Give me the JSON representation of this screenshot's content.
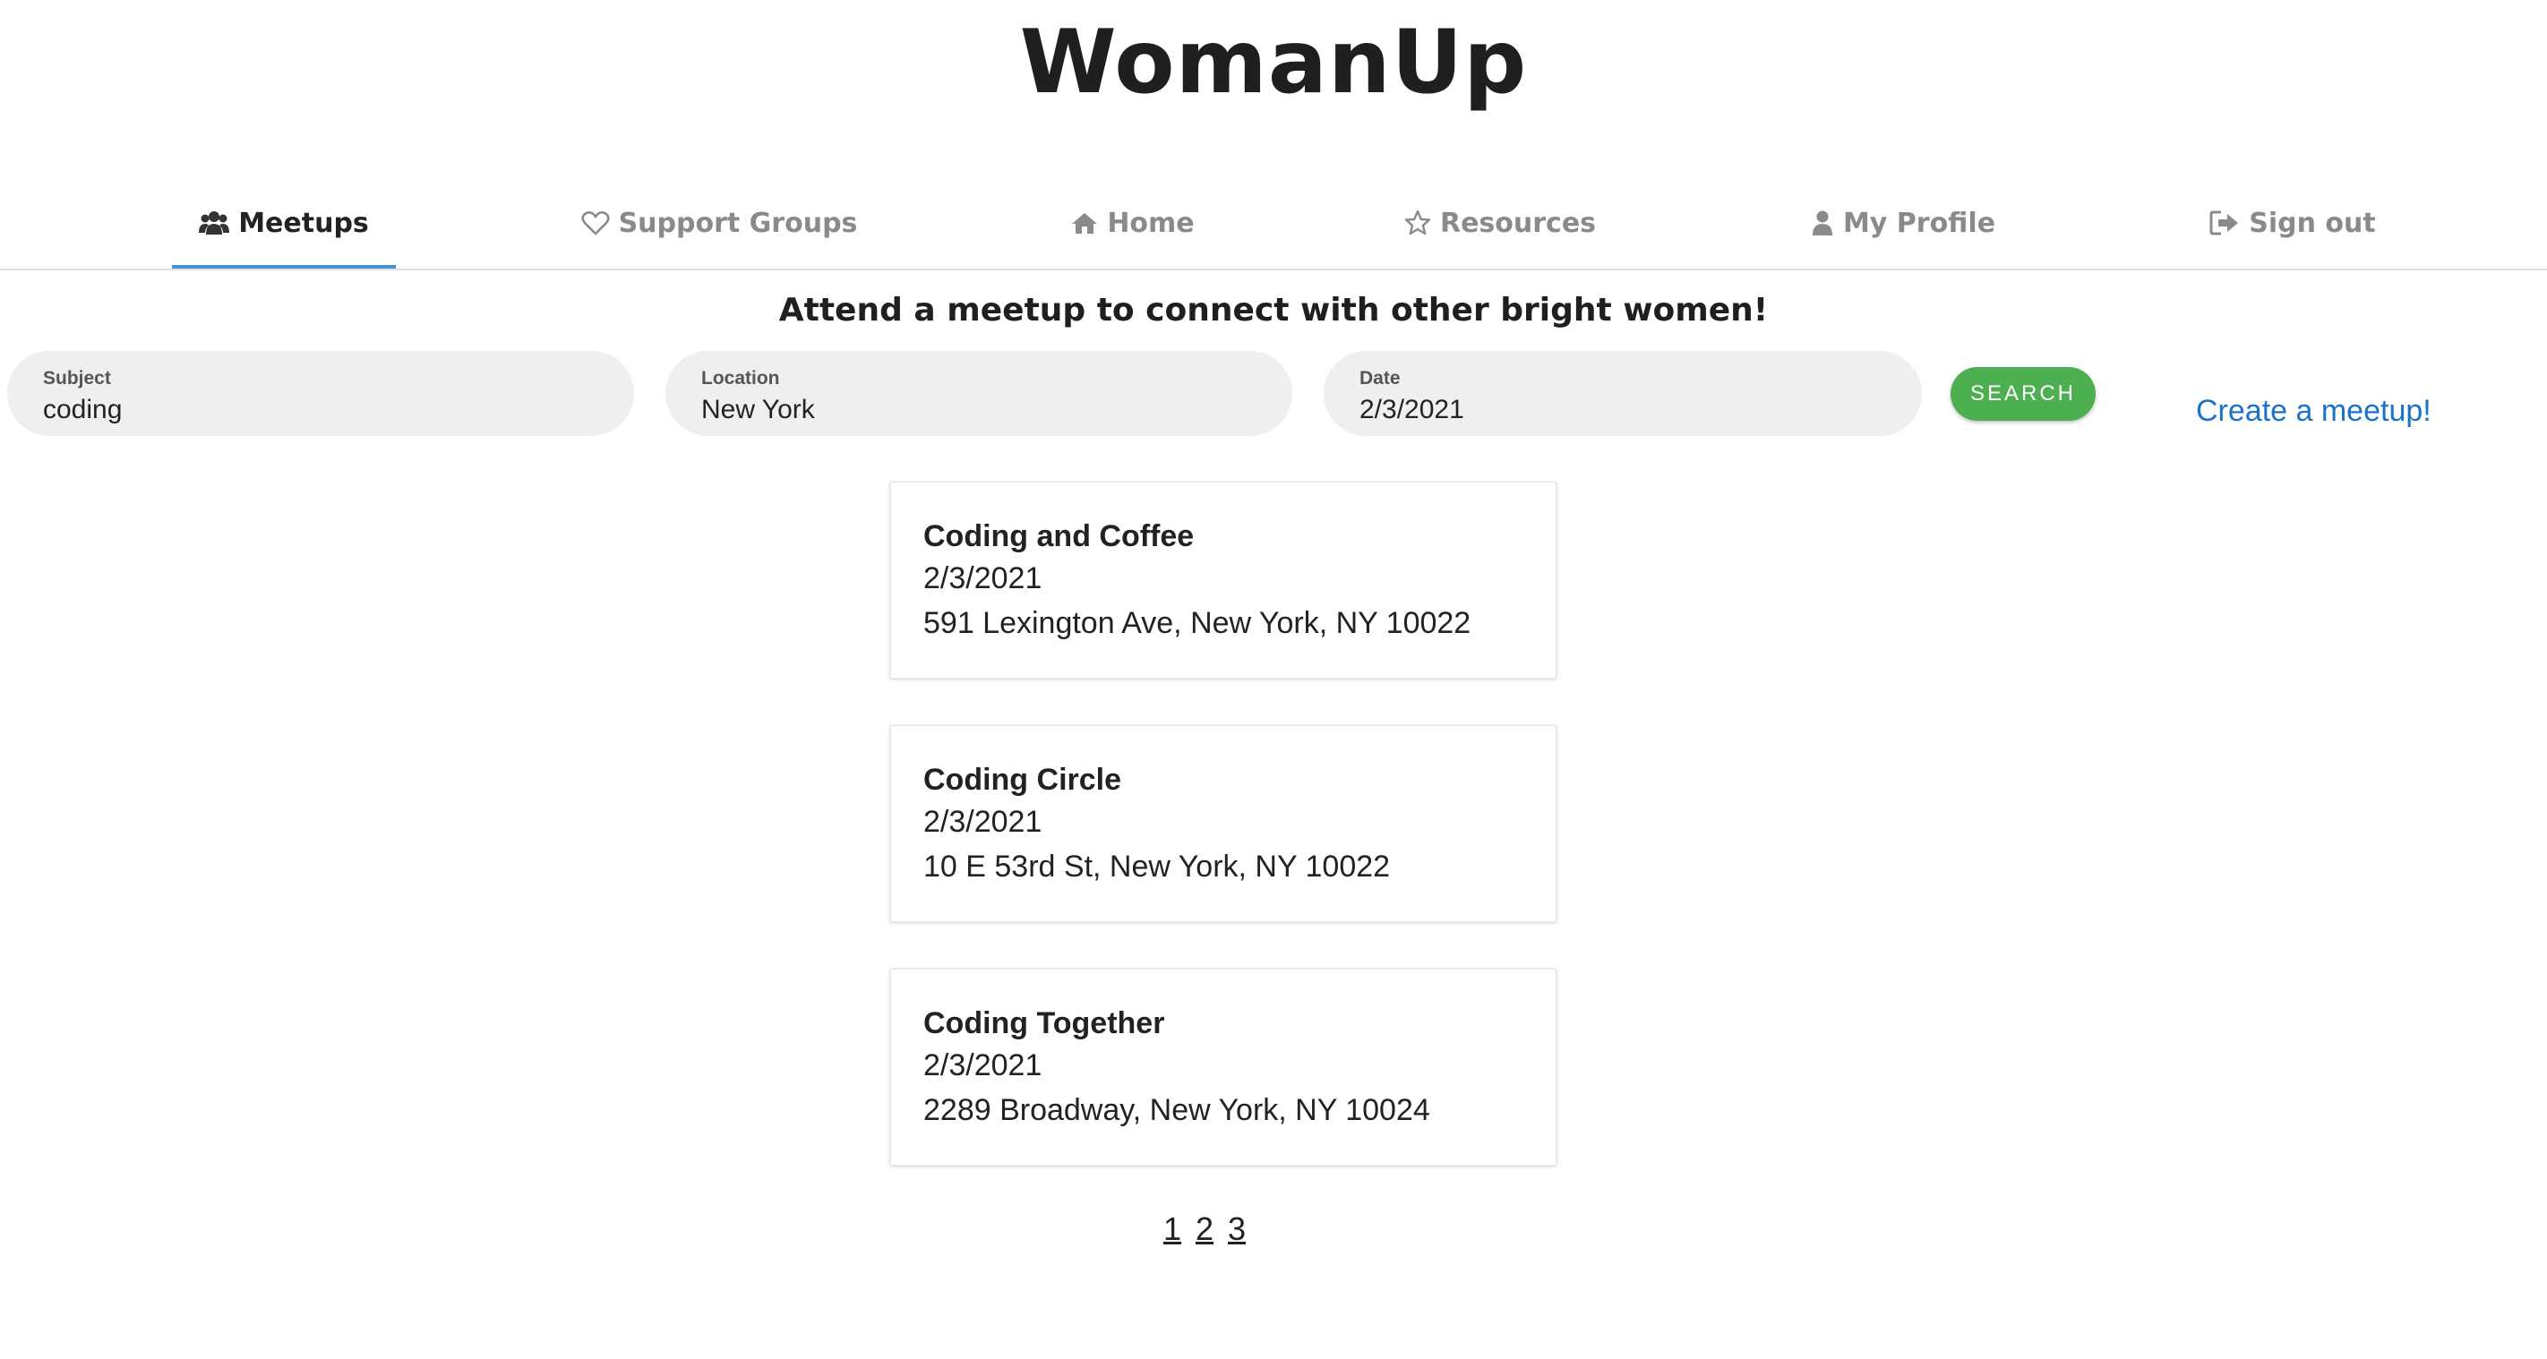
{
  "app": {
    "title": "WomanUp"
  },
  "nav": {
    "tabs": [
      {
        "label": "Meetups",
        "icon": "users-icon",
        "active": true
      },
      {
        "label": "Support Groups",
        "icon": "heart-icon",
        "active": false
      },
      {
        "label": "Home",
        "icon": "home-icon",
        "active": false
      },
      {
        "label": "Resources",
        "icon": "star-icon",
        "active": false
      },
      {
        "label": "My Profile",
        "icon": "user-icon",
        "active": false
      },
      {
        "label": "Sign out",
        "icon": "sign-out-icon",
        "active": false
      }
    ]
  },
  "page": {
    "tagline": "Attend a meetup to connect with other bright women!"
  },
  "search": {
    "subject": {
      "label": "Subject",
      "value": "coding"
    },
    "location": {
      "label": "Location",
      "value": "New York"
    },
    "date": {
      "label": "Date",
      "value": "2/3/2021"
    },
    "button_label": "SEARCH",
    "button_color": "#4caf50"
  },
  "create_link": {
    "label": "Create a meetup!",
    "color": "#1a73c8"
  },
  "meetups": [
    {
      "title": "Coding and Coffee",
      "date": "2/3/2021",
      "address": "591 Lexington Ave, New York, NY 10022"
    },
    {
      "title": "Coding Circle",
      "date": "2/3/2021",
      "address": "10 E 53rd St, New York, NY 10022"
    },
    {
      "title": "Coding Together",
      "date": "2/3/2021",
      "address": "2289 Broadway, New York, NY 10024"
    }
  ],
  "pagination": {
    "pages": [
      "1",
      "2",
      "3"
    ]
  },
  "colors": {
    "active_tab_underline": "#4a90d9",
    "inactive_tab_text": "#8a8a8a"
  }
}
